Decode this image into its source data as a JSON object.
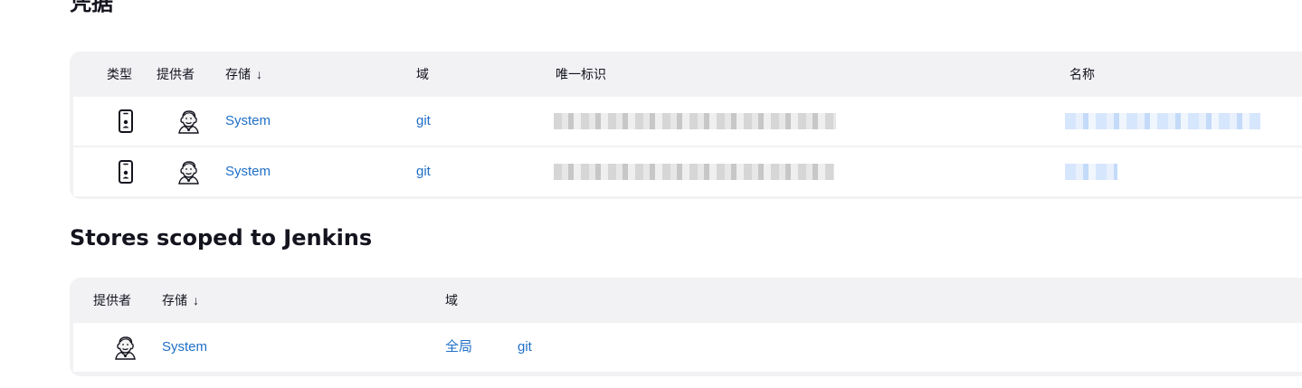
{
  "credentials": {
    "title": "凭据",
    "headers": {
      "type": "类型",
      "provider": "提供者",
      "store": "存储",
      "store_sort_arrow": "↓",
      "domain": "域",
      "id": "唯一标识",
      "name": "名称"
    },
    "rows": [
      {
        "store": "System",
        "domain": "git"
      },
      {
        "store": "System",
        "domain": "git"
      }
    ]
  },
  "stores": {
    "title": "Stores scoped to Jenkins",
    "headers": {
      "provider": "提供者",
      "store": "存储",
      "store_sort_arrow": "↓",
      "domain": "域"
    },
    "rows": [
      {
        "store": "System",
        "domain_global": "全局",
        "domain_git": "git"
      }
    ]
  },
  "icons": {
    "credential_type": "mobile-credential-icon",
    "provider": "jenkins-butler-icon"
  },
  "colors": {
    "link": "#1f6fc7",
    "table_bg": "#f2f2f5",
    "text": "#14141f"
  }
}
